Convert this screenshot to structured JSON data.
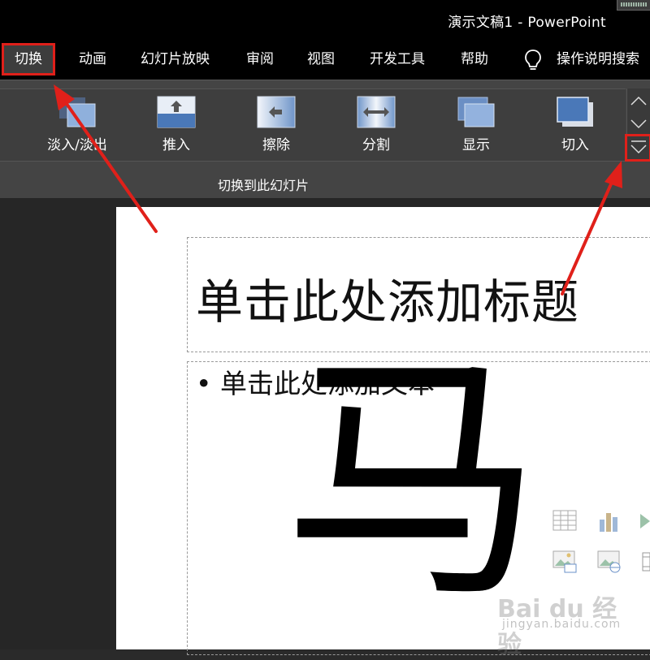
{
  "window": {
    "title": "演示文稿1  -  PowerPoint"
  },
  "menu": {
    "tabs": [
      {
        "label": "切换"
      },
      {
        "label": "动画"
      },
      {
        "label": "幻灯片放映"
      },
      {
        "label": "审阅"
      },
      {
        "label": "视图"
      },
      {
        "label": "开发工具"
      },
      {
        "label": "帮助"
      }
    ],
    "search_label": "操作说明搜索"
  },
  "ribbon": {
    "effects": [
      {
        "label": "淡入/淡出"
      },
      {
        "label": "推入"
      },
      {
        "label": "擦除"
      },
      {
        "label": "分割"
      },
      {
        "label": "显示"
      },
      {
        "label": "切入"
      }
    ],
    "group_label": "切换到此幻灯片"
  },
  "slide": {
    "title_placeholder": "单击此处添加标题",
    "body_placeholder": "• 单击此处添加文本",
    "overlay_glyph": "马"
  },
  "watermark": {
    "brand": "Bai du 经验",
    "url": "jingyan.baidu.com"
  },
  "colors": {
    "highlight": "#e0201a",
    "accent": "#4a78b8"
  }
}
